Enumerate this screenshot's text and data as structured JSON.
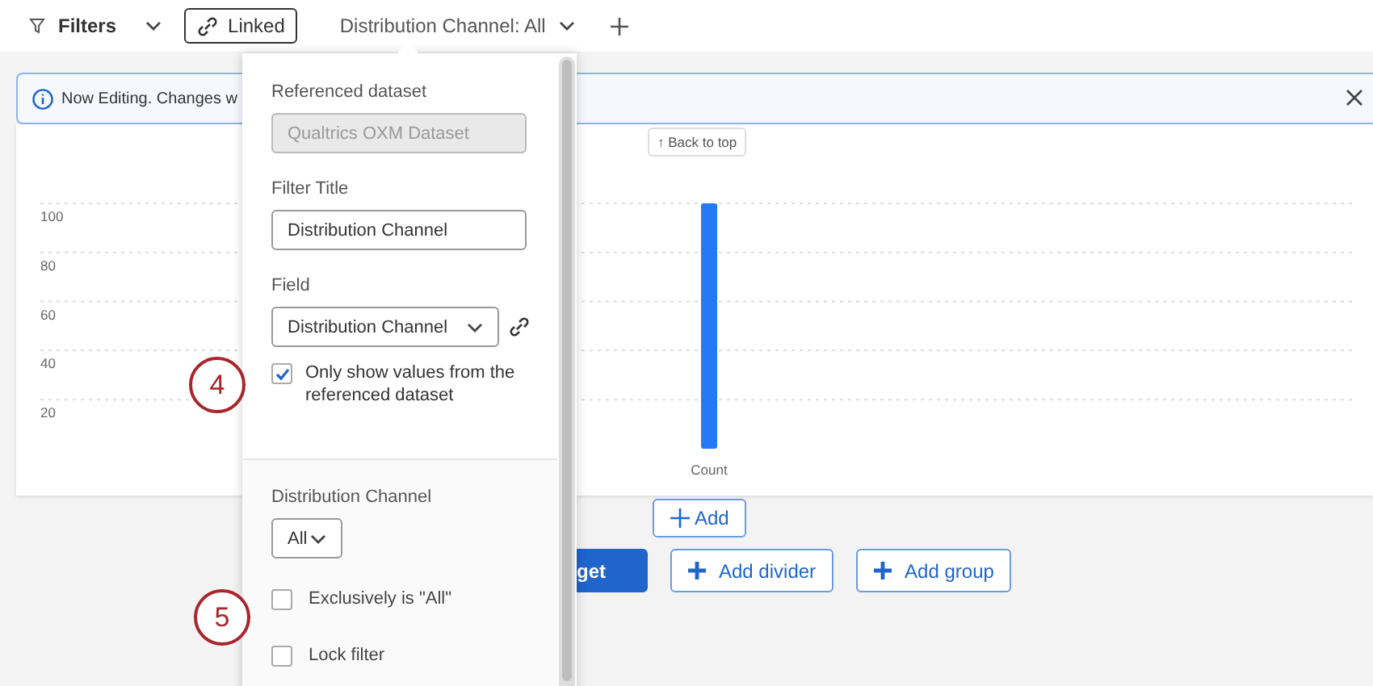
{
  "toolbar": {
    "filters_label": "Filters",
    "linked_button": "Linked",
    "filter_chip": "Distribution Channel: All"
  },
  "banner": {
    "text": "Now Editing. Changes w"
  },
  "back_to_top": "↑ Back to top",
  "chart": {
    "chart_data": {
      "type": "bar",
      "categories": [
        "Count"
      ],
      "values": [
        100
      ],
      "ylim": [
        -19.08,
        132.2
      ],
      "grid": true,
      "yticks": [
        20,
        40,
        60,
        80,
        100
      ]
    }
  },
  "add_button": "Add",
  "actions": [
    {
      "label": "get",
      "kind": "primary"
    },
    {
      "label": "Add divider",
      "kind": "secondary"
    },
    {
      "label": "Add group",
      "kind": "secondary"
    }
  ],
  "popup": {
    "referenced_dataset": {
      "label": "Referenced dataset",
      "value": "Qualtrics OXM Dataset",
      "disabled": true
    },
    "filter_title": {
      "label": "Filter Title",
      "value": "Distribution Channel"
    },
    "field": {
      "label": "Field",
      "value": "Distribution Channel"
    },
    "only_show_values": {
      "label": "Only show values from the referenced dataset",
      "checked": true
    },
    "values": {
      "label": "Distribution Channel",
      "value": "All"
    },
    "options": [
      {
        "label": "Exclusively is \"All\"",
        "checked": false
      },
      {
        "label": "Lock filter",
        "checked": false
      }
    ]
  },
  "callouts": [
    "4",
    "5"
  ]
}
